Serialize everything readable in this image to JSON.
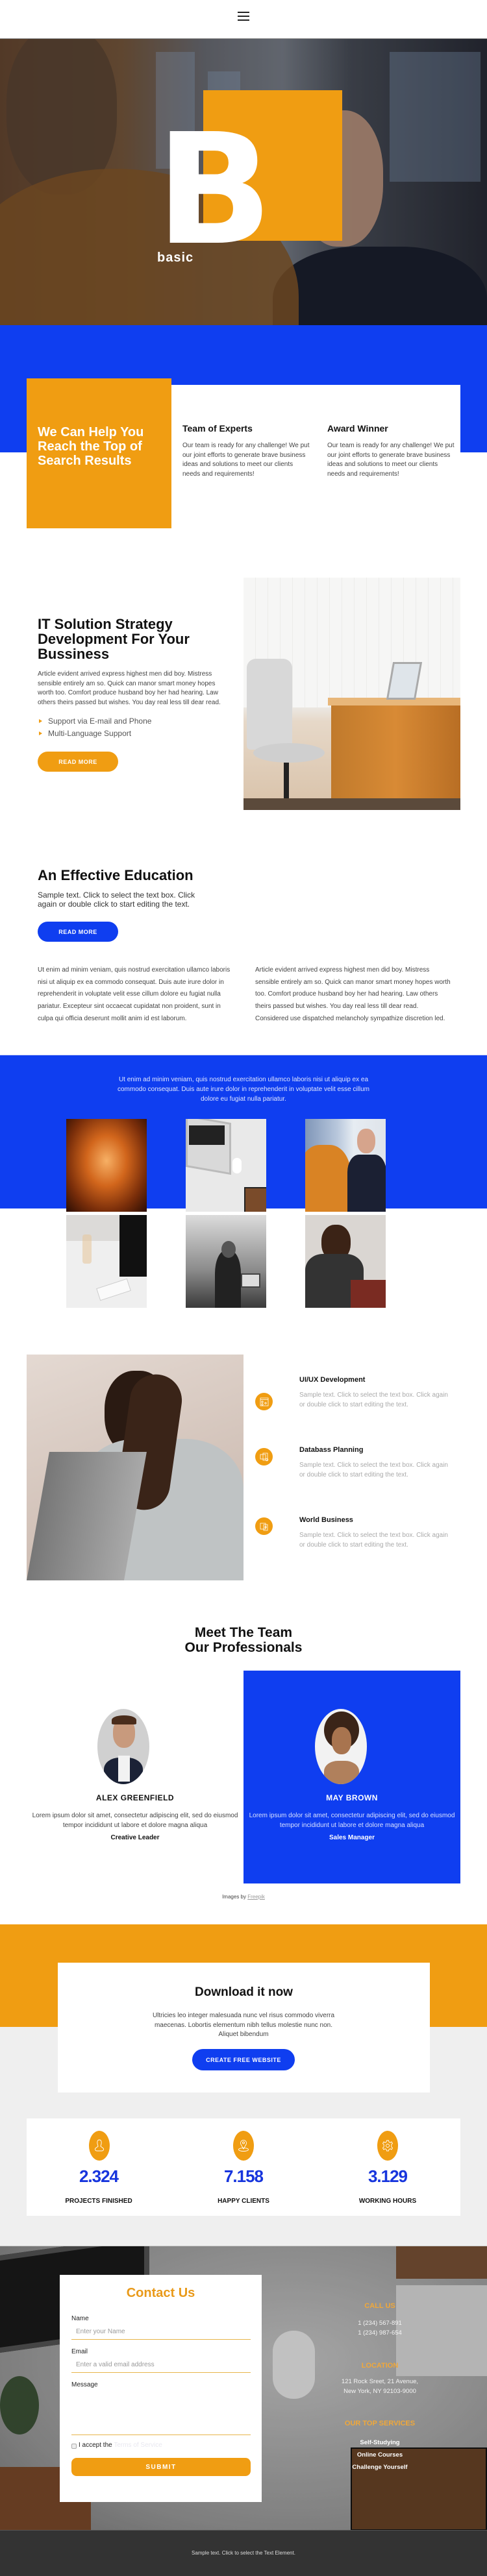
{
  "header": {
    "menu_icon": "hamburger-menu-icon"
  },
  "hero": {
    "logo_letter": "B",
    "logo_text": "basic"
  },
  "colors": {
    "accent_orange": "#f09d12",
    "accent_blue": "#0f3ef0",
    "dark": "#333333"
  },
  "intro": {
    "title": "We Can Help You Reach the Top of Search Results",
    "features": [
      {
        "title": "Team of Experts",
        "text": "Our team is ready for any challenge! We put our joint efforts to generate brave business ideas and solutions to meet our clients needs and requirements!"
      },
      {
        "title": "Award Winner",
        "text": "Our team is ready for any challenge! We put our joint efforts to generate brave business ideas and solutions to meet our clients needs and requirements!"
      }
    ]
  },
  "it_section": {
    "title": "IT Solution Strategy Development For Your Bussiness",
    "text": "Article evident arrived express highest men did boy. Mistress sensible entirely am so. Quick can manor smart money hopes worth too. Comfort produce husband boy her had hearing. Law others theirs passed but wishes. You day real less till dear read.",
    "list": [
      "Support via E-mail and Phone",
      "Multi-Language Support"
    ],
    "button": "READ MORE"
  },
  "education": {
    "title": "An Effective Education",
    "subtitle": "Sample text. Click to select the text box. Click again or double click to start editing the text.",
    "button": "READ MORE",
    "col1": "Ut enim ad minim veniam, quis nostrud exercitation ullamco laboris nisi ut aliquip ex ea commodo consequat. Duis aute irure dolor in reprehenderit in voluptate velit esse cillum dolore eu fugiat nulla pariatur. Excepteur sint occaecat cupidatat non proident, sunt in culpa qui officia deserunt mollit anim id est laborum.",
    "col2": "Article evident arrived express highest men did boy. Mistress sensible entirely am so. Quick can manor smart money hopes worth too. Comfort produce husband boy her had hearing. Law others theirs passed but wishes. You day real less till dear read. Considered use dispatched melancholy sympathize discretion led."
  },
  "gallery": {
    "text": "Ut enim ad minim veniam, quis nostrud exercitation ullamco laboris nisi ut aliquip ex ea commodo consequat. Duis aute irure dolor in reprehenderit in voluptate velit esse cillum dolore eu fugiat nulla pariatur.",
    "images": [
      "canyon-photo",
      "laptop-desk-photo",
      "business-meeting-photo",
      "desk-computer-photo",
      "team-meeting-photo",
      "student-headphones-photo"
    ]
  },
  "services": [
    {
      "title": "UI/UX Development",
      "text": "Sample text. Click to select the text box. Click again or double click to start editing the text.",
      "icon": "ui-ux-icon"
    },
    {
      "title": "Databass Planning",
      "text": "Sample text. Click to select the text box. Click again or double click to start editing the text.",
      "icon": "database-code-icon"
    },
    {
      "title": "World Business",
      "text": "Sample text. Click to select the text box. Click again or double click to start editing the text.",
      "icon": "business-devices-icon"
    }
  ],
  "team": {
    "title_line1": "Meet The Team",
    "title_line2": "Our Professionals",
    "members": [
      {
        "name": "ALEX GREENFIELD",
        "text": "Lorem ipsum dolor sit amet, consectetur adipiscing elit, sed do eiusmod tempor incididunt ut labore et dolore magna aliqua",
        "role": "Creative Leader"
      },
      {
        "name": "MAY BROWN",
        "text": "Lorem ipsum dolor sit amet, consectetur adipiscing elit, sed do eiusmod tempor incididunt ut labore et dolore magna aliqua",
        "role": "Sales Manager"
      }
    ],
    "credit_prefix": "Images by",
    "credit_link": "Freepik"
  },
  "download": {
    "title": "Download it now",
    "text": "Ultricies leo integer malesuada nunc vel risus commodo viverra maecenas. Lobortis elementum nibh tellus molestie nunc non. Aliquet bibendum",
    "button": "CREATE FREE WEBSITE"
  },
  "stats": [
    {
      "value": "2.324",
      "label": "PROJECTS FINISHED",
      "icon": "user-icon"
    },
    {
      "value": "7.158",
      "label": "HAPPY CLIENTS",
      "icon": "location-pin-icon"
    },
    {
      "value": "3.129",
      "label": "WORKING HOURS",
      "icon": "gear-icon"
    }
  ],
  "contact": {
    "title": "Contact Us",
    "name_label": "Name",
    "name_placeholder": "Enter your Name",
    "email_label": "Email",
    "email_placeholder": "Enter a valid email address",
    "message_label": "Message",
    "accept_text": "I accept the",
    "terms_link": "Terms of Service",
    "submit": "SUBMIT",
    "call_title": "CALL US",
    "phone1": "1 (234) 567-891",
    "phone2": "1 (234) 987-654",
    "location_title": "LOCATION",
    "address1": "121 Rock Sreet, 21 Avenue,",
    "address2": "New York, NY 92103-9000",
    "services_title": "OUR TOP SERVICES",
    "services": [
      "Self-Studying",
      "Online Courses",
      "Challenge Yourself"
    ]
  },
  "footer": {
    "text": "Sample text. Click to select the Text Element."
  }
}
